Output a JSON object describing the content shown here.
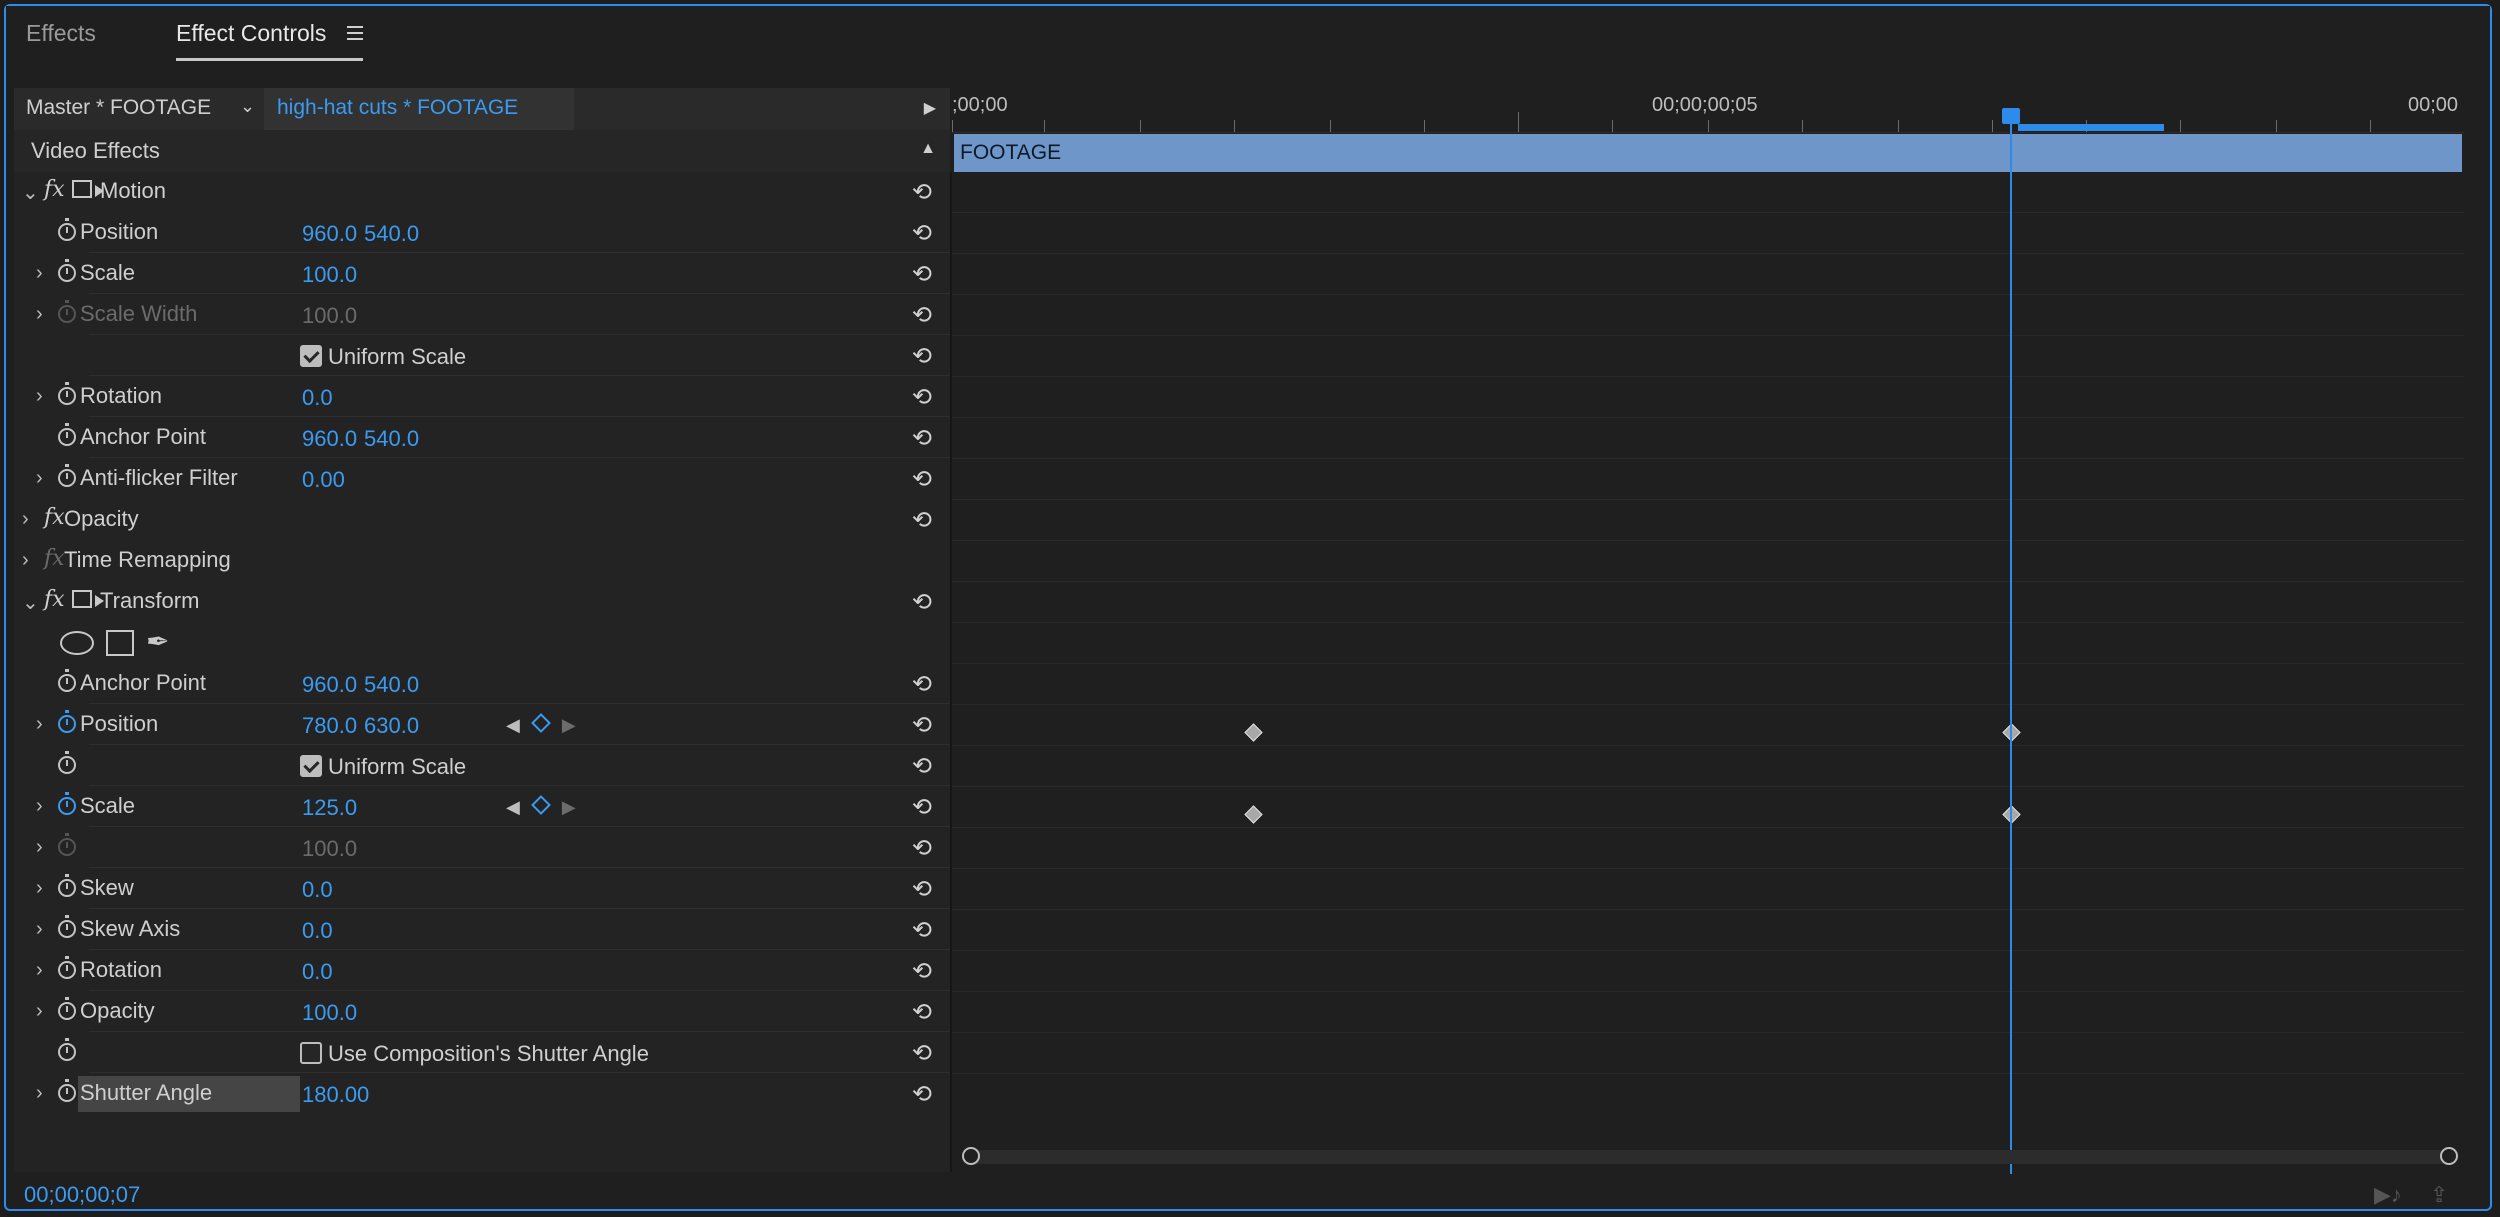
{
  "tabs": [
    {
      "label": "Effects",
      "active": false
    },
    {
      "label": "Effect Controls",
      "active": true
    }
  ],
  "header": {
    "master_clip": "Master * FOOTAGE",
    "sequence_clip": "high-hat cuts * FOOTAGE"
  },
  "video_effects_label": "Video Effects",
  "motion": {
    "name": "Motion",
    "position": {
      "label": "Position",
      "x": "960.0",
      "y": "540.0"
    },
    "scale": {
      "label": "Scale",
      "value": "100.0"
    },
    "scale_width": {
      "label": "Scale Width",
      "value": "100.0"
    },
    "uniform_scale": {
      "label": "Uniform Scale",
      "checked": true
    },
    "rotation": {
      "label": "Rotation",
      "value": "0.0"
    },
    "anchor_point": {
      "label": "Anchor Point",
      "x": "960.0",
      "y": "540.0"
    },
    "anti_flicker": {
      "label": "Anti-flicker Filter",
      "value": "0.00"
    }
  },
  "opacity_effect": {
    "name": "Opacity"
  },
  "time_remapping": {
    "name": "Time Remapping"
  },
  "transform": {
    "name": "Transform",
    "anchor_point": {
      "label": "Anchor Point",
      "x": "960.0",
      "y": "540.0"
    },
    "position": {
      "label": "Position",
      "x": "780.0",
      "y": "630.0"
    },
    "uniform_scale": {
      "label": "Uniform Scale",
      "checked": true
    },
    "scale": {
      "label": "Scale",
      "value": "125.0"
    },
    "scale_width": {
      "value": "100.0"
    },
    "skew": {
      "label": "Skew",
      "value": "0.0"
    },
    "skew_axis": {
      "label": "Skew Axis",
      "value": "0.0"
    },
    "rotation": {
      "label": "Rotation",
      "value": "0.0"
    },
    "opacity": {
      "label": "Opacity",
      "value": "100.0"
    },
    "use_comp_shutter": {
      "label": "Use Composition's Shutter Angle",
      "checked": false
    },
    "shutter_angle": {
      "label": "Shutter Angle",
      "value": "180.00"
    }
  },
  "timeline": {
    "ruler_start": ";00;00",
    "ruler_mid": "00;00;00;05",
    "ruler_end": "00;00",
    "clip_label": "FOOTAGE"
  },
  "current_timecode": "00;00;00;07",
  "accent_color": "#2d8ceb",
  "value_color": "#3b9bf0",
  "icons": [
    "stopwatch-icon",
    "reset-icon",
    "fx-icon",
    "transform-icon",
    "ellipse-mask-icon",
    "rectangle-mask-icon",
    "pen-mask-icon",
    "keyframe-icon",
    "menu-icon"
  ]
}
